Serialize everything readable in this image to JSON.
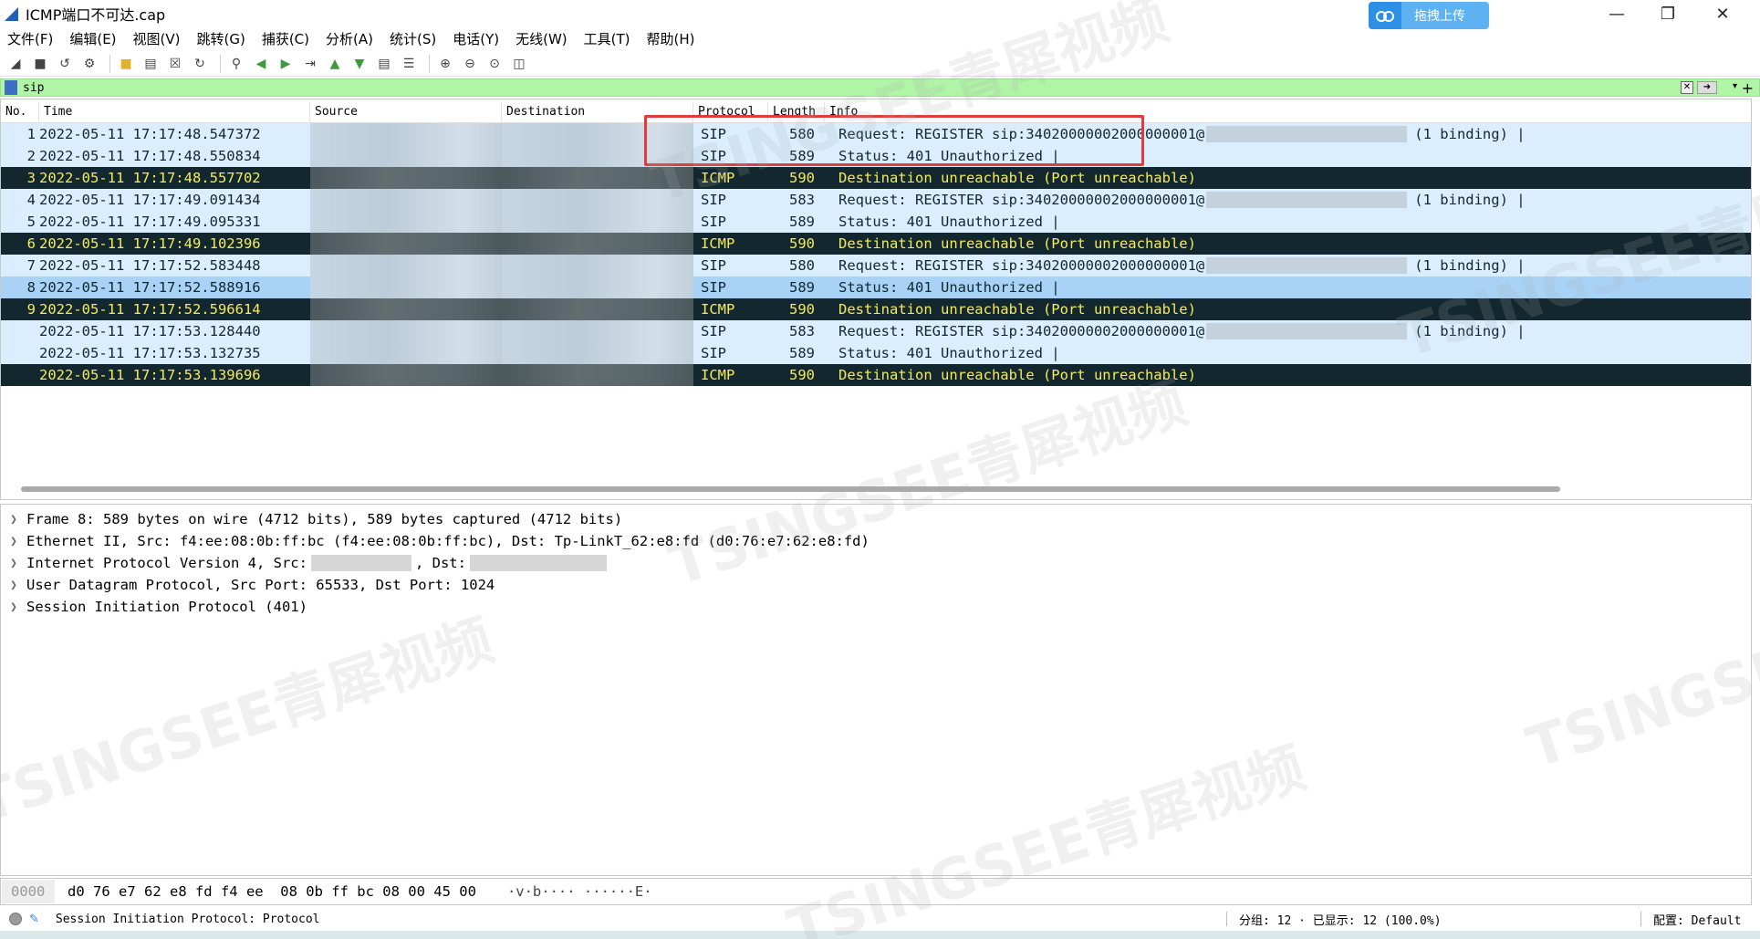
{
  "window": {
    "title": "ICMP端口不可达.cap",
    "upload_label": "拖拽上传"
  },
  "menu": [
    "文件(F)",
    "编辑(E)",
    "视图(V)",
    "跳转(G)",
    "捕获(C)",
    "分析(A)",
    "统计(S)",
    "电话(Y)",
    "无线(W)",
    "工具(T)",
    "帮助(H)"
  ],
  "filter": {
    "value": "sip"
  },
  "columns": {
    "no": "No.",
    "time": "Time",
    "source": "Source",
    "destination": "Destination",
    "protocol": "Protocol",
    "length": "Length",
    "info": "Info"
  },
  "packets": [
    {
      "no": "1",
      "time": "2022-05-11 17:17:48.547372",
      "protocol": "SIP",
      "length": "580",
      "info": "Request: REGISTER sip:34020000002000000001@",
      "info_tail": "(1 binding) |",
      "kind": "sip"
    },
    {
      "no": "2",
      "time": "2022-05-11 17:17:48.550834",
      "protocol": "SIP",
      "length": "589",
      "info": "Status: 401 Unauthorized |",
      "info_tail": "",
      "kind": "sip"
    },
    {
      "no": "3",
      "time": "2022-05-11 17:17:48.557702",
      "protocol": "ICMP",
      "length": "590",
      "info": "Destination unreachable (Port unreachable)",
      "info_tail": "",
      "kind": "icmp"
    },
    {
      "no": "4",
      "time": "2022-05-11 17:17:49.091434",
      "protocol": "SIP",
      "length": "583",
      "info": "Request: REGISTER sip:34020000002000000001@",
      "info_tail": "(1 binding) |",
      "kind": "sip"
    },
    {
      "no": "5",
      "time": "2022-05-11 17:17:49.095331",
      "protocol": "SIP",
      "length": "589",
      "info": "Status: 401 Unauthorized |",
      "info_tail": "",
      "kind": "sip"
    },
    {
      "no": "6",
      "time": "2022-05-11 17:17:49.102396",
      "protocol": "ICMP",
      "length": "590",
      "info": "Destination unreachable (Port unreachable)",
      "info_tail": "",
      "kind": "icmp"
    },
    {
      "no": "7",
      "time": "2022-05-11 17:17:52.583448",
      "protocol": "SIP",
      "length": "580",
      "info": "Request: REGISTER sip:34020000002000000001@",
      "info_tail": "(1 binding) |",
      "kind": "sip"
    },
    {
      "no": "8",
      "time": "2022-05-11 17:17:52.588916",
      "protocol": "SIP",
      "length": "589",
      "info": "Status: 401 Unauthorized |",
      "info_tail": "",
      "kind": "sel"
    },
    {
      "no": "9",
      "time": "2022-05-11 17:17:52.596614",
      "protocol": "ICMP",
      "length": "590",
      "info": "Destination unreachable (Port unreachable)",
      "info_tail": "",
      "kind": "icmp"
    },
    {
      "no": "",
      "time": "2022-05-11 17:17:53.128440",
      "protocol": "SIP",
      "length": "583",
      "info": "Request: REGISTER sip:34020000002000000001@",
      "info_tail": "(1 binding) |",
      "kind": "sip"
    },
    {
      "no": "",
      "time": "2022-05-11 17:17:53.132735",
      "protocol": "SIP",
      "length": "589",
      "info": "Status: 401 Unauthorized |",
      "info_tail": "",
      "kind": "sip"
    },
    {
      "no": "",
      "time": "2022-05-11 17:17:53.139696",
      "protocol": "ICMP",
      "length": "590",
      "info": "Destination unreachable (Port unreachable)",
      "info_tail": "",
      "kind": "icmp"
    }
  ],
  "details": [
    {
      "text": "Frame 8: 589 bytes on wire (4712 bits), 589 bytes captured (4712 bits)"
    },
    {
      "text": "Ethernet II, Src: f4:ee:08:0b:ff:bc (f4:ee:08:0b:ff:bc), Dst: Tp-LinkT_62:e8:fd (d0:76:e7:62:e8:fd)"
    },
    {
      "text_pre": "Internet Protocol Version 4, Src:",
      "text_mid": ", Dst:"
    },
    {
      "text": "User Datagram Protocol, Src Port: 65533, Dst Port: 1024"
    },
    {
      "text": "Session Initiation Protocol (401)"
    }
  ],
  "bytes": {
    "offset": "0000",
    "hex": "d0 76 e7 62 e8 fd f4 ee  08 0b ff bc 08 00 45 00",
    "ascii": "·v·b···· ······E·"
  },
  "status": {
    "text": "Session Initiation Protocol: Protocol",
    "packets": "分组: 12 · 已显示: 12 (100.0%)",
    "profile": "配置: Default"
  },
  "watermark": "TSINGSEE青犀视频",
  "colors": {
    "sip_row": "#daeeff",
    "selected_row": "#a8d3f7",
    "icmp_row_bg": "#12272e",
    "icmp_row_fg": "#f5eb5c",
    "filter_bg": "#aff5a5",
    "highlight": "#e23b3b"
  }
}
